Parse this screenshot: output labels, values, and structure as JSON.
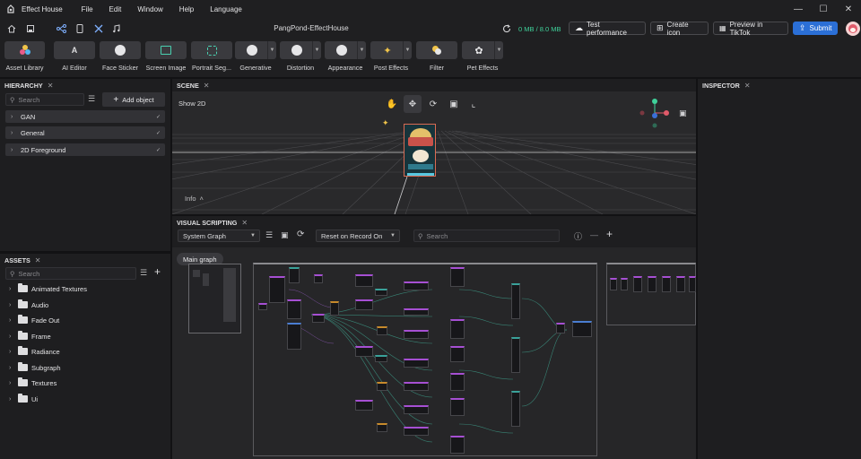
{
  "titlebar": {
    "app_name": "Effect House",
    "menu": [
      "File",
      "Edit",
      "Window",
      "Help",
      "Language"
    ]
  },
  "header": {
    "project_name": "PangPond-EffectHouse",
    "memory": "0 MB / 8.0 MB",
    "test_performance": "Test performance",
    "create_icon": "Create icon",
    "preview": "Preview in TikTok",
    "submit": "Submit"
  },
  "toolbar": {
    "items": [
      {
        "label": "Asset Library",
        "icon": "asset-library-icon"
      },
      {
        "label": "AI Editor",
        "icon": "ai-editor-icon"
      },
      {
        "label": "Face Sticker",
        "icon": "face-sticker-icon"
      },
      {
        "label": "Screen Image",
        "icon": "screen-image-icon"
      },
      {
        "label": "Portrait Seg...",
        "icon": "portrait-seg-icon"
      },
      {
        "label": "Generative",
        "icon": "generative-icon"
      },
      {
        "label": "Distortion",
        "icon": "distortion-icon"
      },
      {
        "label": "Appearance",
        "icon": "appearance-icon"
      },
      {
        "label": "Post Effects",
        "icon": "post-effects-icon"
      },
      {
        "label": "Filter",
        "icon": "filter-icon"
      },
      {
        "label": "Pet Effects",
        "icon": "pet-effects-icon"
      }
    ]
  },
  "hierarchy": {
    "title": "HIERARCHY",
    "search_placeholder": "Search",
    "add_object": "Add object",
    "items": [
      "GAN",
      "General",
      "2D Foreground"
    ]
  },
  "assets": {
    "title": "ASSETS",
    "search_placeholder": "Search",
    "folders": [
      "Animated Textures",
      "Audio",
      "Fade Out",
      "Frame",
      "Radiance",
      "Subgraph",
      "Textures",
      "Ui"
    ]
  },
  "scene": {
    "title": "SCENE",
    "show_2d": "Show 2D",
    "info": "Info"
  },
  "visual_scripting": {
    "title": "VISUAL SCRIPTING",
    "graph_select": "System Graph",
    "reset_select": "Reset on Record On",
    "search_placeholder": "Search",
    "tab": "Main graph"
  },
  "inspector": {
    "title": "INSPECTOR"
  },
  "colors": {
    "accent": "#2b6fd6",
    "memory_green": "#3fd19a",
    "node_purple": "#a64fd3",
    "node_teal": "#3aa29a"
  }
}
